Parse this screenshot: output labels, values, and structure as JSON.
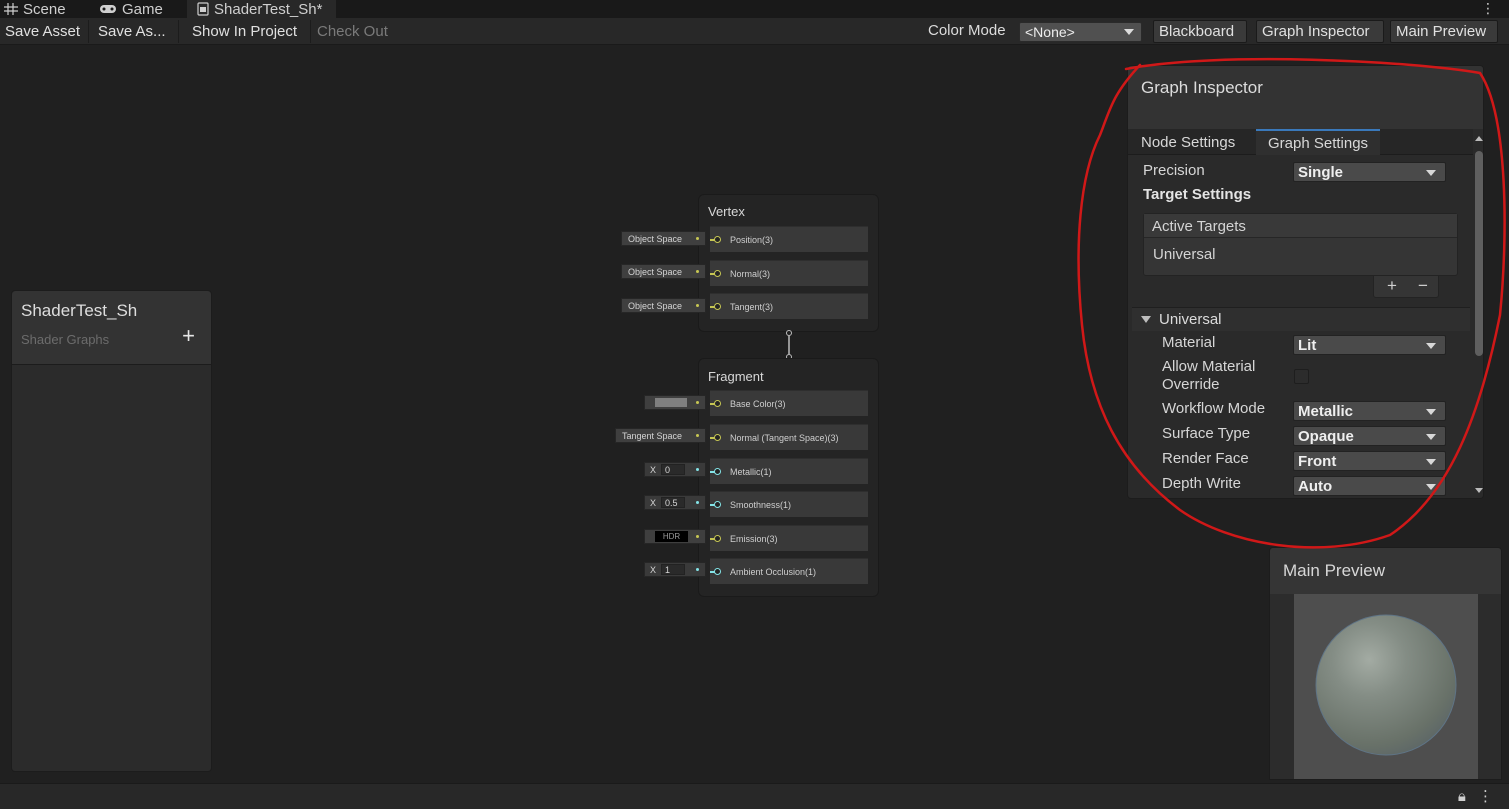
{
  "tabs": [
    {
      "label": "Scene",
      "icon": "grid-icon"
    },
    {
      "label": "Game",
      "icon": "gamepad-icon"
    },
    {
      "label": "ShaderTest_Sh*",
      "icon": "shader-icon",
      "active": true
    }
  ],
  "toolbar": {
    "save_asset": "Save Asset",
    "save_as": "Save As...",
    "show_in_project": "Show In Project",
    "check_out": "Check Out",
    "color_mode_label": "Color Mode",
    "color_mode_value": "<None>",
    "blackboard": "Blackboard",
    "graph_inspector": "Graph Inspector",
    "main_preview": "Main Preview"
  },
  "blackboard": {
    "title": "ShaderTest_Sh",
    "subtitle": "Shader Graphs",
    "add": "+"
  },
  "vertex": {
    "title": "Vertex",
    "slots": [
      {
        "label": "Position(3)",
        "input": "Object Space"
      },
      {
        "label": "Normal(3)",
        "input": "Object Space"
      },
      {
        "label": "Tangent(3)",
        "input": "Object Space"
      }
    ]
  },
  "fragment": {
    "title": "Fragment",
    "base_color": {
      "label": "Base Color(3)",
      "swatch": "#7f7f7f"
    },
    "normal": {
      "label": "Normal (Tangent Space)(3)",
      "input": "Tangent Space"
    },
    "metallic": {
      "label": "Metallic(1)",
      "x": "X",
      "value": "0"
    },
    "smoothness": {
      "label": "Smoothness(1)",
      "x": "X",
      "value": "0.5"
    },
    "emission": {
      "label": "Emission(3)",
      "input": "HDR"
    },
    "occlusion": {
      "label": "Ambient Occlusion(1)",
      "x": "X",
      "value": "1"
    }
  },
  "inspector": {
    "title": "Graph Inspector",
    "tabs": [
      "Node Settings",
      "Graph Settings"
    ],
    "precision_label": "Precision",
    "precision_value": "Single",
    "target_settings": "Target Settings",
    "active_targets": "Active Targets",
    "target_item": "Universal",
    "plus": "+",
    "minus": "−",
    "section": "Universal",
    "material_label": "Material",
    "material_value": "Lit",
    "allow_override_label_1": "Allow Material",
    "allow_override_label_2": "Override",
    "workflow_label": "Workflow Mode",
    "workflow_value": "Metallic",
    "surface_label": "Surface Type",
    "surface_value": "Opaque",
    "render_face_label": "Render Face",
    "render_face_value": "Front",
    "depth_write_label": "Depth Write",
    "depth_write_value": "Auto"
  },
  "preview": {
    "title": "Main Preview"
  },
  "status": {
    "icons": [
      "lock-icon",
      "more-icon"
    ]
  },
  "colors": {
    "vector_port": "#c6c653",
    "float_port": "#84e4e7",
    "tab_accent": "#3a79bb",
    "annotation": "#d01818"
  }
}
